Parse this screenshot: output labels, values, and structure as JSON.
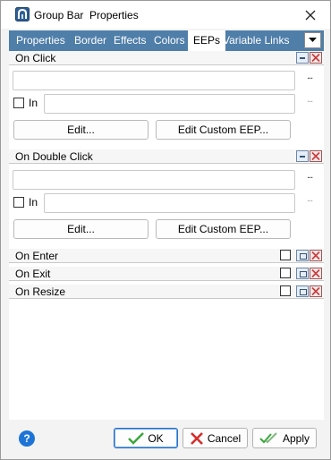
{
  "window": {
    "title": "Group Bar  Properties"
  },
  "tabs": [
    {
      "label": "Properties"
    },
    {
      "label": "Border"
    },
    {
      "label": "Effects"
    },
    {
      "label": "Colors"
    },
    {
      "label": "EEPs",
      "active": true
    },
    {
      "label": "Variable Links"
    }
  ],
  "sections": {
    "on_click": {
      "label": "On Click",
      "expression_value": "",
      "in_label": "In",
      "in_value": "",
      "ellipsis": "...",
      "edit_label": "Edit...",
      "edit_custom_label": "Edit Custom EEP..."
    },
    "on_double_click": {
      "label": "On Double Click",
      "expression_value": "",
      "in_label": "In",
      "in_value": "",
      "ellipsis": "...",
      "edit_label": "Edit...",
      "edit_custom_label": "Edit Custom EEP..."
    },
    "on_enter": {
      "label": "On Enter"
    },
    "on_exit": {
      "label": "On Exit"
    },
    "on_resize": {
      "label": "On Resize"
    }
  },
  "footer": {
    "help_label": "?",
    "ok_label": "OK",
    "cancel_label": "Cancel",
    "apply_label": "Apply"
  },
  "colors": {
    "tab_strip": "#4f7ea9",
    "ok_check": "#3aa63a",
    "cancel_x": "#d62c2c",
    "help": "#1e74d6",
    "remove_x": "#c83a3a"
  },
  "icons": {
    "app": "group-bar-app-icon",
    "close": "close-icon",
    "tab_menu": "chevron-down-icon",
    "collapse": "collapse-icon",
    "remove": "remove-icon",
    "edit": "edit-icon",
    "help": "help-icon",
    "ok": "check-icon",
    "cancel": "x-icon",
    "apply": "double-check-icon"
  }
}
